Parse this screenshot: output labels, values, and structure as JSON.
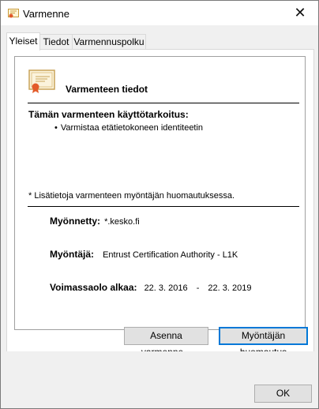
{
  "window": {
    "title": "Varmenne",
    "close_glyph": "✕"
  },
  "tabs": [
    {
      "label": "Yleiset",
      "active": true
    },
    {
      "label": "Tiedot",
      "active": false
    },
    {
      "label": "Varmennuspolku",
      "active": false
    }
  ],
  "general": {
    "heading": "Varmenteen tiedot",
    "purpose_title": "Tämän varmenteen käyttötarkoitus:",
    "purposes": [
      "Varmistaa etätietokoneen identiteetin"
    ],
    "bullet": "•",
    "note": "* Lisätietoja varmenteen myöntäjän huomautuksessa.",
    "issued_to_label": "Myönnetty:",
    "issued_to_value": "*.kesko.fi",
    "issuer_label": "Myöntäjä:",
    "issuer_value": "Entrust Certification Authority - L1K",
    "valid_from_label": "Voimassaolo alkaa:",
    "valid_from_value": "22. 3. 2016",
    "valid_sep": "-",
    "valid_to_value": "22. 3. 2019"
  },
  "buttons": {
    "install": "Asenna varmenne...",
    "issuer_statement": "Myöntäjän huomautus",
    "ok": "OK"
  },
  "colors": {
    "accent": "#0078d7",
    "button_bg": "#e1e1e1",
    "dialog_bg": "#f0f0f0"
  }
}
